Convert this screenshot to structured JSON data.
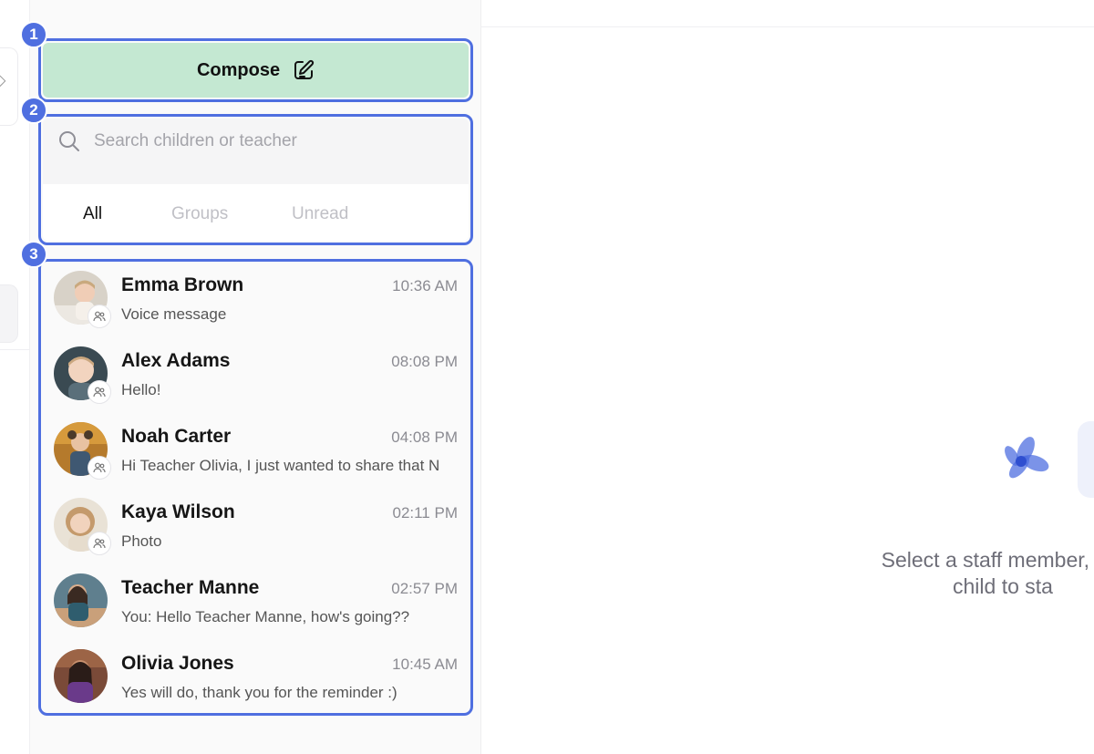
{
  "compose": {
    "label": "Compose",
    "icon": "edit-icon"
  },
  "search": {
    "placeholder": "Search children or teacher",
    "value": ""
  },
  "tabs": [
    {
      "label": "All",
      "active": true
    },
    {
      "label": "Groups",
      "active": false
    },
    {
      "label": "Unread",
      "active": false
    }
  ],
  "annotations": [
    "1",
    "2",
    "3"
  ],
  "conversations": [
    {
      "name": "Emma Brown",
      "time": "10:36 AM",
      "preview": "Voice message",
      "group": true
    },
    {
      "name": "Alex Adams",
      "time": "08:08 PM",
      "preview": "Hello!",
      "group": true
    },
    {
      "name": "Noah Carter",
      "time": "04:08 PM",
      "preview": "Hi Teacher Olivia, I just wanted to share that N",
      "group": true
    },
    {
      "name": "Kaya Wilson",
      "time": "02:11 PM",
      "preview": "Photo",
      "group": true
    },
    {
      "name": "Teacher Manne",
      "time": "02:57 PM",
      "preview": "You: Hello Teacher Manne, how's going??",
      "group": false
    },
    {
      "name": "Olivia Jones",
      "time": "10:45 AM",
      "preview": "Yes will do, thank you for the reminder :)",
      "group": false
    }
  ],
  "empty_state": {
    "line1": "Select a staff member, cre",
    "line2": "child to sta"
  },
  "colors": {
    "compose_bg": "#c4e8d2",
    "highlight": "#4f6fe0",
    "logo": "#4f6fe0"
  }
}
